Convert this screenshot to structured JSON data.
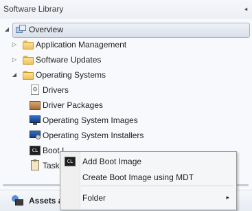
{
  "panel": {
    "title": "Software Library",
    "collapse_glyph": "◂"
  },
  "tree": {
    "overview": {
      "label": "Overview",
      "expander": "◢",
      "icon": "overview-icon"
    },
    "children": [
      {
        "label": "Application Management",
        "expander": "▷",
        "icon": "folder-icon"
      },
      {
        "label": "Software Updates",
        "expander": "▷",
        "icon": "folder-icon"
      },
      {
        "label": "Operating Systems",
        "expander": "◢",
        "icon": "folder-icon"
      }
    ],
    "os_children": [
      {
        "label": "Drivers",
        "icon": "driver-icon"
      },
      {
        "label": "Driver Packages",
        "icon": "driver-package-icon"
      },
      {
        "label": "Operating System Images",
        "icon": "os-image-icon"
      },
      {
        "label": "Operating System Installers",
        "icon": "os-installer-icon"
      },
      {
        "label": "Boot I",
        "icon": "boot-image-icon"
      },
      {
        "label": "Task",
        "icon": "task-sequence-icon"
      }
    ]
  },
  "bottom_nav": {
    "assets_label": "Assets a",
    "icon": "assets-icon"
  },
  "context_menu": {
    "items": [
      {
        "label": "Add Boot Image",
        "icon": "boot-image-icon"
      },
      {
        "label": "Create Boot Image using MDT"
      },
      {
        "label": "Folder",
        "submenu_glyph": "▸"
      }
    ]
  }
}
